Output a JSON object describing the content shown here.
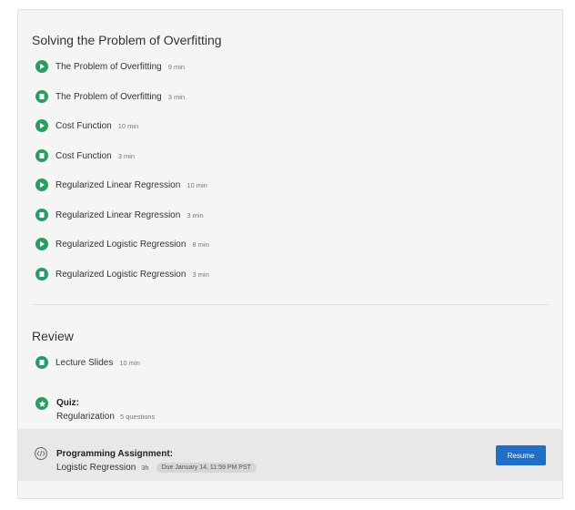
{
  "colors": {
    "accent_green": "#2a9d64",
    "resume_blue": "#1f6fc9"
  },
  "sections": [
    {
      "title": "Solving the Problem of Overfitting",
      "items": [
        {
          "type": "video",
          "icon": "play-icon",
          "label": "The Problem of Overfitting",
          "duration": "9 min"
        },
        {
          "type": "reading",
          "icon": "document-icon",
          "label": "The Problem of Overfitting",
          "duration": "3 min"
        },
        {
          "type": "video",
          "icon": "play-icon",
          "label": "Cost Function",
          "duration": "10 min"
        },
        {
          "type": "reading",
          "icon": "document-icon",
          "label": "Cost Function",
          "duration": "3 min"
        },
        {
          "type": "video",
          "icon": "play-icon",
          "label": "Regularized Linear Regression",
          "duration": "10 min"
        },
        {
          "type": "reading",
          "icon": "document-icon",
          "label": "Regularized Linear Regression",
          "duration": "3 min"
        },
        {
          "type": "video",
          "icon": "play-icon",
          "label": "Regularized Logistic Regression",
          "duration": "8 min"
        },
        {
          "type": "reading",
          "icon": "document-icon",
          "label": "Regularized Logistic Regression",
          "duration": "3 min"
        }
      ]
    },
    {
      "title": "Review",
      "items": [
        {
          "type": "reading",
          "icon": "document-icon",
          "label": "Lecture Slides",
          "duration": "10 min"
        }
      ]
    }
  ],
  "quiz": {
    "icon": "star-icon",
    "title": "Quiz:",
    "name": "Regularization",
    "meta": "5 questions"
  },
  "assignment": {
    "icon": "code-icon",
    "title": "Programming Assignment:",
    "name": "Logistic Regression",
    "hours": "3h",
    "due": "Due January 14, 11:59 PM PST",
    "button_label": "Resume"
  }
}
